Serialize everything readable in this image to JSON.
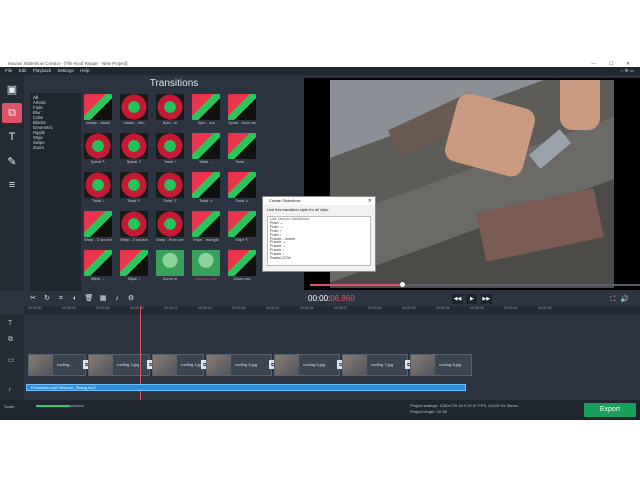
{
  "window": {
    "title": "Movavi Slideshow Creator - [Tile Roof Repair - New Project]",
    "menu": [
      "File",
      "Edit",
      "Playback",
      "Settings",
      "Help"
    ]
  },
  "panel": {
    "title": "Transitions",
    "categories": [
      "All",
      "Artistic",
      "Fade",
      "Blur",
      "Cube",
      "Blocks",
      "Geometric",
      "Ripple",
      "Wipe",
      "Swipe",
      "Zoom"
    ],
    "selected_category": "All",
    "tiles": [
      {
        "label": "Intake - black",
        "style": "v2"
      },
      {
        "label": "Intake - thin",
        "style": "v1"
      },
      {
        "label": "Spin - in",
        "style": "v1"
      },
      {
        "label": "Spin - out",
        "style": "v2"
      },
      {
        "label": "Spiral - from center",
        "style": "v2"
      },
      {
        "label": "Spiral ↖",
        "style": "v1"
      },
      {
        "label": "Spiral ↗",
        "style": "v1"
      },
      {
        "label": "Twist ↑",
        "style": "v1"
      },
      {
        "label": "Twist ←",
        "style": "v2"
      },
      {
        "label": "Twist →",
        "style": "v2"
      },
      {
        "label": "Twist ↓",
        "style": "v1"
      },
      {
        "label": "Twist ↖",
        "style": "v1"
      },
      {
        "label": "Twist ↗",
        "style": "v1"
      },
      {
        "label": "Twist ↘",
        "style": "v2"
      },
      {
        "label": "Twist ↙",
        "style": "v2"
      },
      {
        "label": "Warp - 2 sources →",
        "style": "v2"
      },
      {
        "label": "Warp - 3 sources →",
        "style": "v1"
      },
      {
        "label": "Warp - from center",
        "style": "v1"
      },
      {
        "label": "Wipe - triangle",
        "style": "v2"
      },
      {
        "label": "Wipe ↖",
        "style": "v2"
      },
      {
        "label": "Wipe →",
        "style": "v2"
      },
      {
        "label": "Wipe ↓",
        "style": "v2"
      },
      {
        "label": "Zoom in",
        "style": "v3"
      },
      {
        "label": "Zoom in-out",
        "style": "v3"
      },
      {
        "label": "Zoom out",
        "style": "v2"
      }
    ]
  },
  "dialog": {
    "title": "Create Slideshow",
    "description": "Use this transition style for all clips:",
    "options": [
      "Use random transitions",
      "Push ←",
      "Push →",
      "Push ↑",
      "Push ↓",
      "Puzzle - corner",
      "Puzzle ←",
      "Puzzle →",
      "Puzzle ↓",
      "Puzzle ↑",
      "Radial CCW"
    ]
  },
  "playback": {
    "time_main": "00:00:",
    "time_ms": "06.860",
    "progress": 0.28
  },
  "timeline": {
    "ruler": [
      "00:00:00",
      "00:00:03",
      "00:00:06",
      "00:00:09",
      "00:00:12",
      "00:00:15",
      "00:00:18",
      "00:00:21",
      "00:00:24",
      "00:00:27",
      "00:00:30",
      "00:00:33",
      "00:00:36",
      "00:00:39",
      "00:00:42",
      "00:00:45"
    ],
    "clips": [
      "roofing...",
      "roofing 3.jpg",
      "roofing 4.jpg",
      "roofing 5.jpg",
      "roofing 6.jpg",
      "roofing 7.jpg",
      "roofing 8.jpg"
    ],
    "audio_label": "Fiximacher.mp3 Rickover_Sliding.mp3"
  },
  "status": {
    "scale_label": "Scale:",
    "zoom_level": 0.7,
    "project_settings": "Project settings:  1280x720 16:9 29.97 FPS, 44100 Hz Stereo",
    "project_length": "Project length:  00:38",
    "export_label": "Export"
  },
  "colors": {
    "accent": "#e0546a",
    "export": "#19a05a",
    "audio": "#2d8fd9"
  }
}
